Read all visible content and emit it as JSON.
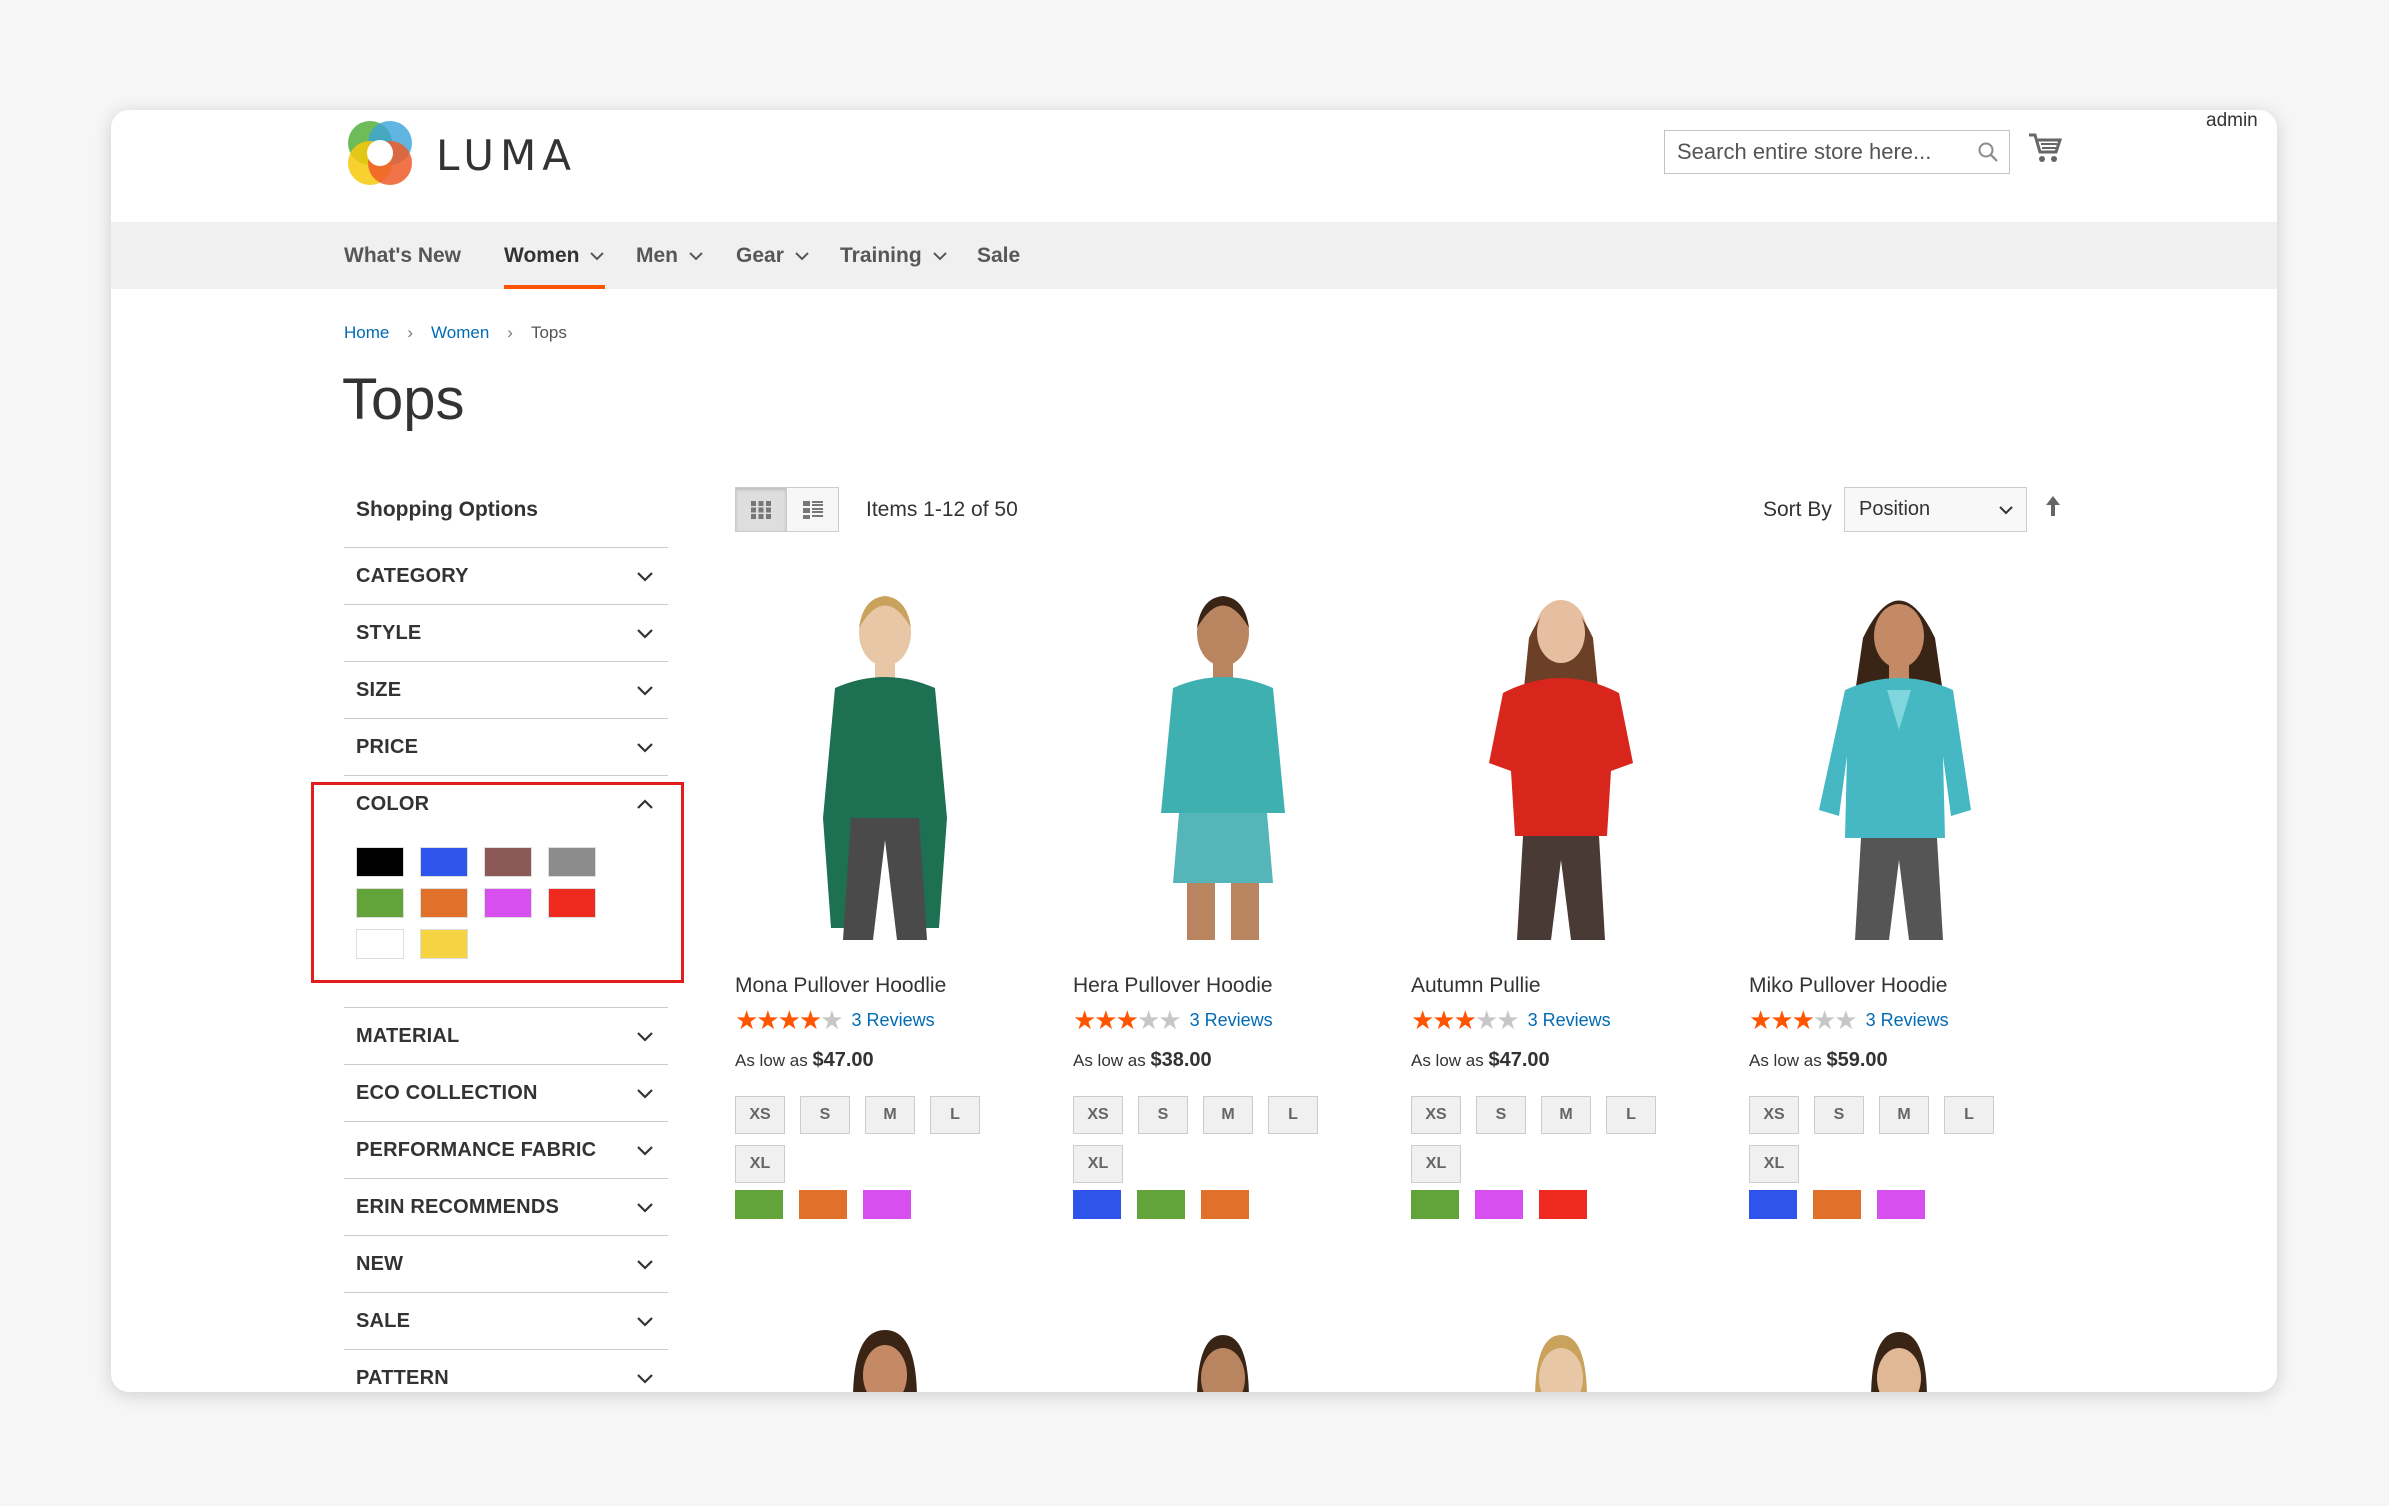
{
  "header": {
    "brand": "LUMA",
    "user": "admin",
    "search_placeholder": "Search entire store here..."
  },
  "nav": {
    "items": [
      {
        "label": "What's New",
        "has_menu": false
      },
      {
        "label": "Women",
        "has_menu": true,
        "active": true
      },
      {
        "label": "Men",
        "has_menu": true
      },
      {
        "label": "Gear",
        "has_menu": true
      },
      {
        "label": "Training",
        "has_menu": true
      },
      {
        "label": "Sale",
        "has_menu": false
      }
    ]
  },
  "breadcrumb": [
    "Home",
    "Women",
    "Tops"
  ],
  "page_title": "Tops",
  "sidebar": {
    "title": "Shopping Options",
    "filters": [
      "CATEGORY",
      "STYLE",
      "SIZE",
      "PRICE",
      "COLOR",
      "MATERIAL",
      "ECO COLLECTION",
      "PERFORMANCE FABRIC",
      "ERIN RECOMMENDS",
      "NEW",
      "SALE",
      "PATTERN"
    ],
    "color_swatches": [
      "#000000",
      "#2f54eb",
      "#8c5959",
      "#8c8c8c",
      "#62a33a",
      "#e0702a",
      "#d84ff0",
      "#ed2a1d",
      "#ffffff",
      "#f5d342"
    ]
  },
  "toolbar": {
    "items_count": "Items 1-12 of 50",
    "sort_label": "Sort By",
    "sort_value": "Position"
  },
  "products": [
    {
      "name": "Mona Pullover Hoodlie",
      "rating": 4,
      "reviews": "3  Reviews",
      "price_prefix": "As low as ",
      "price": "$47.00",
      "sizes": [
        "XS",
        "S",
        "M",
        "L",
        "XL"
      ],
      "colors": [
        "#62a33a",
        "#e0702a",
        "#d84ff0"
      ],
      "garment_color": "#1e7052"
    },
    {
      "name": "Hera Pullover Hoodie",
      "rating": 3,
      "reviews": "3  Reviews",
      "price_prefix": "As low as ",
      "price": "$38.00",
      "sizes": [
        "XS",
        "S",
        "M",
        "L",
        "XL"
      ],
      "colors": [
        "#2f54eb",
        "#62a33a",
        "#e0702a"
      ],
      "garment_color": "#3eb0b0"
    },
    {
      "name": "Autumn Pullie",
      "rating": 3,
      "reviews": "3  Reviews",
      "price_prefix": "As low as ",
      "price": "$47.00",
      "sizes": [
        "XS",
        "S",
        "M",
        "L",
        "XL"
      ],
      "colors": [
        "#62a33a",
        "#d84ff0",
        "#ed2a1d"
      ],
      "garment_color": "#d8261d"
    },
    {
      "name": "Miko Pullover Hoodie",
      "rating": 3,
      "reviews": "3  Reviews",
      "price_prefix": "As low as ",
      "price": "$59.00",
      "sizes": [
        "XS",
        "S",
        "M",
        "L",
        "XL"
      ],
      "colors": [
        "#2f54eb",
        "#e0702a",
        "#d84ff0"
      ],
      "garment_color": "#45b8c4"
    }
  ]
}
